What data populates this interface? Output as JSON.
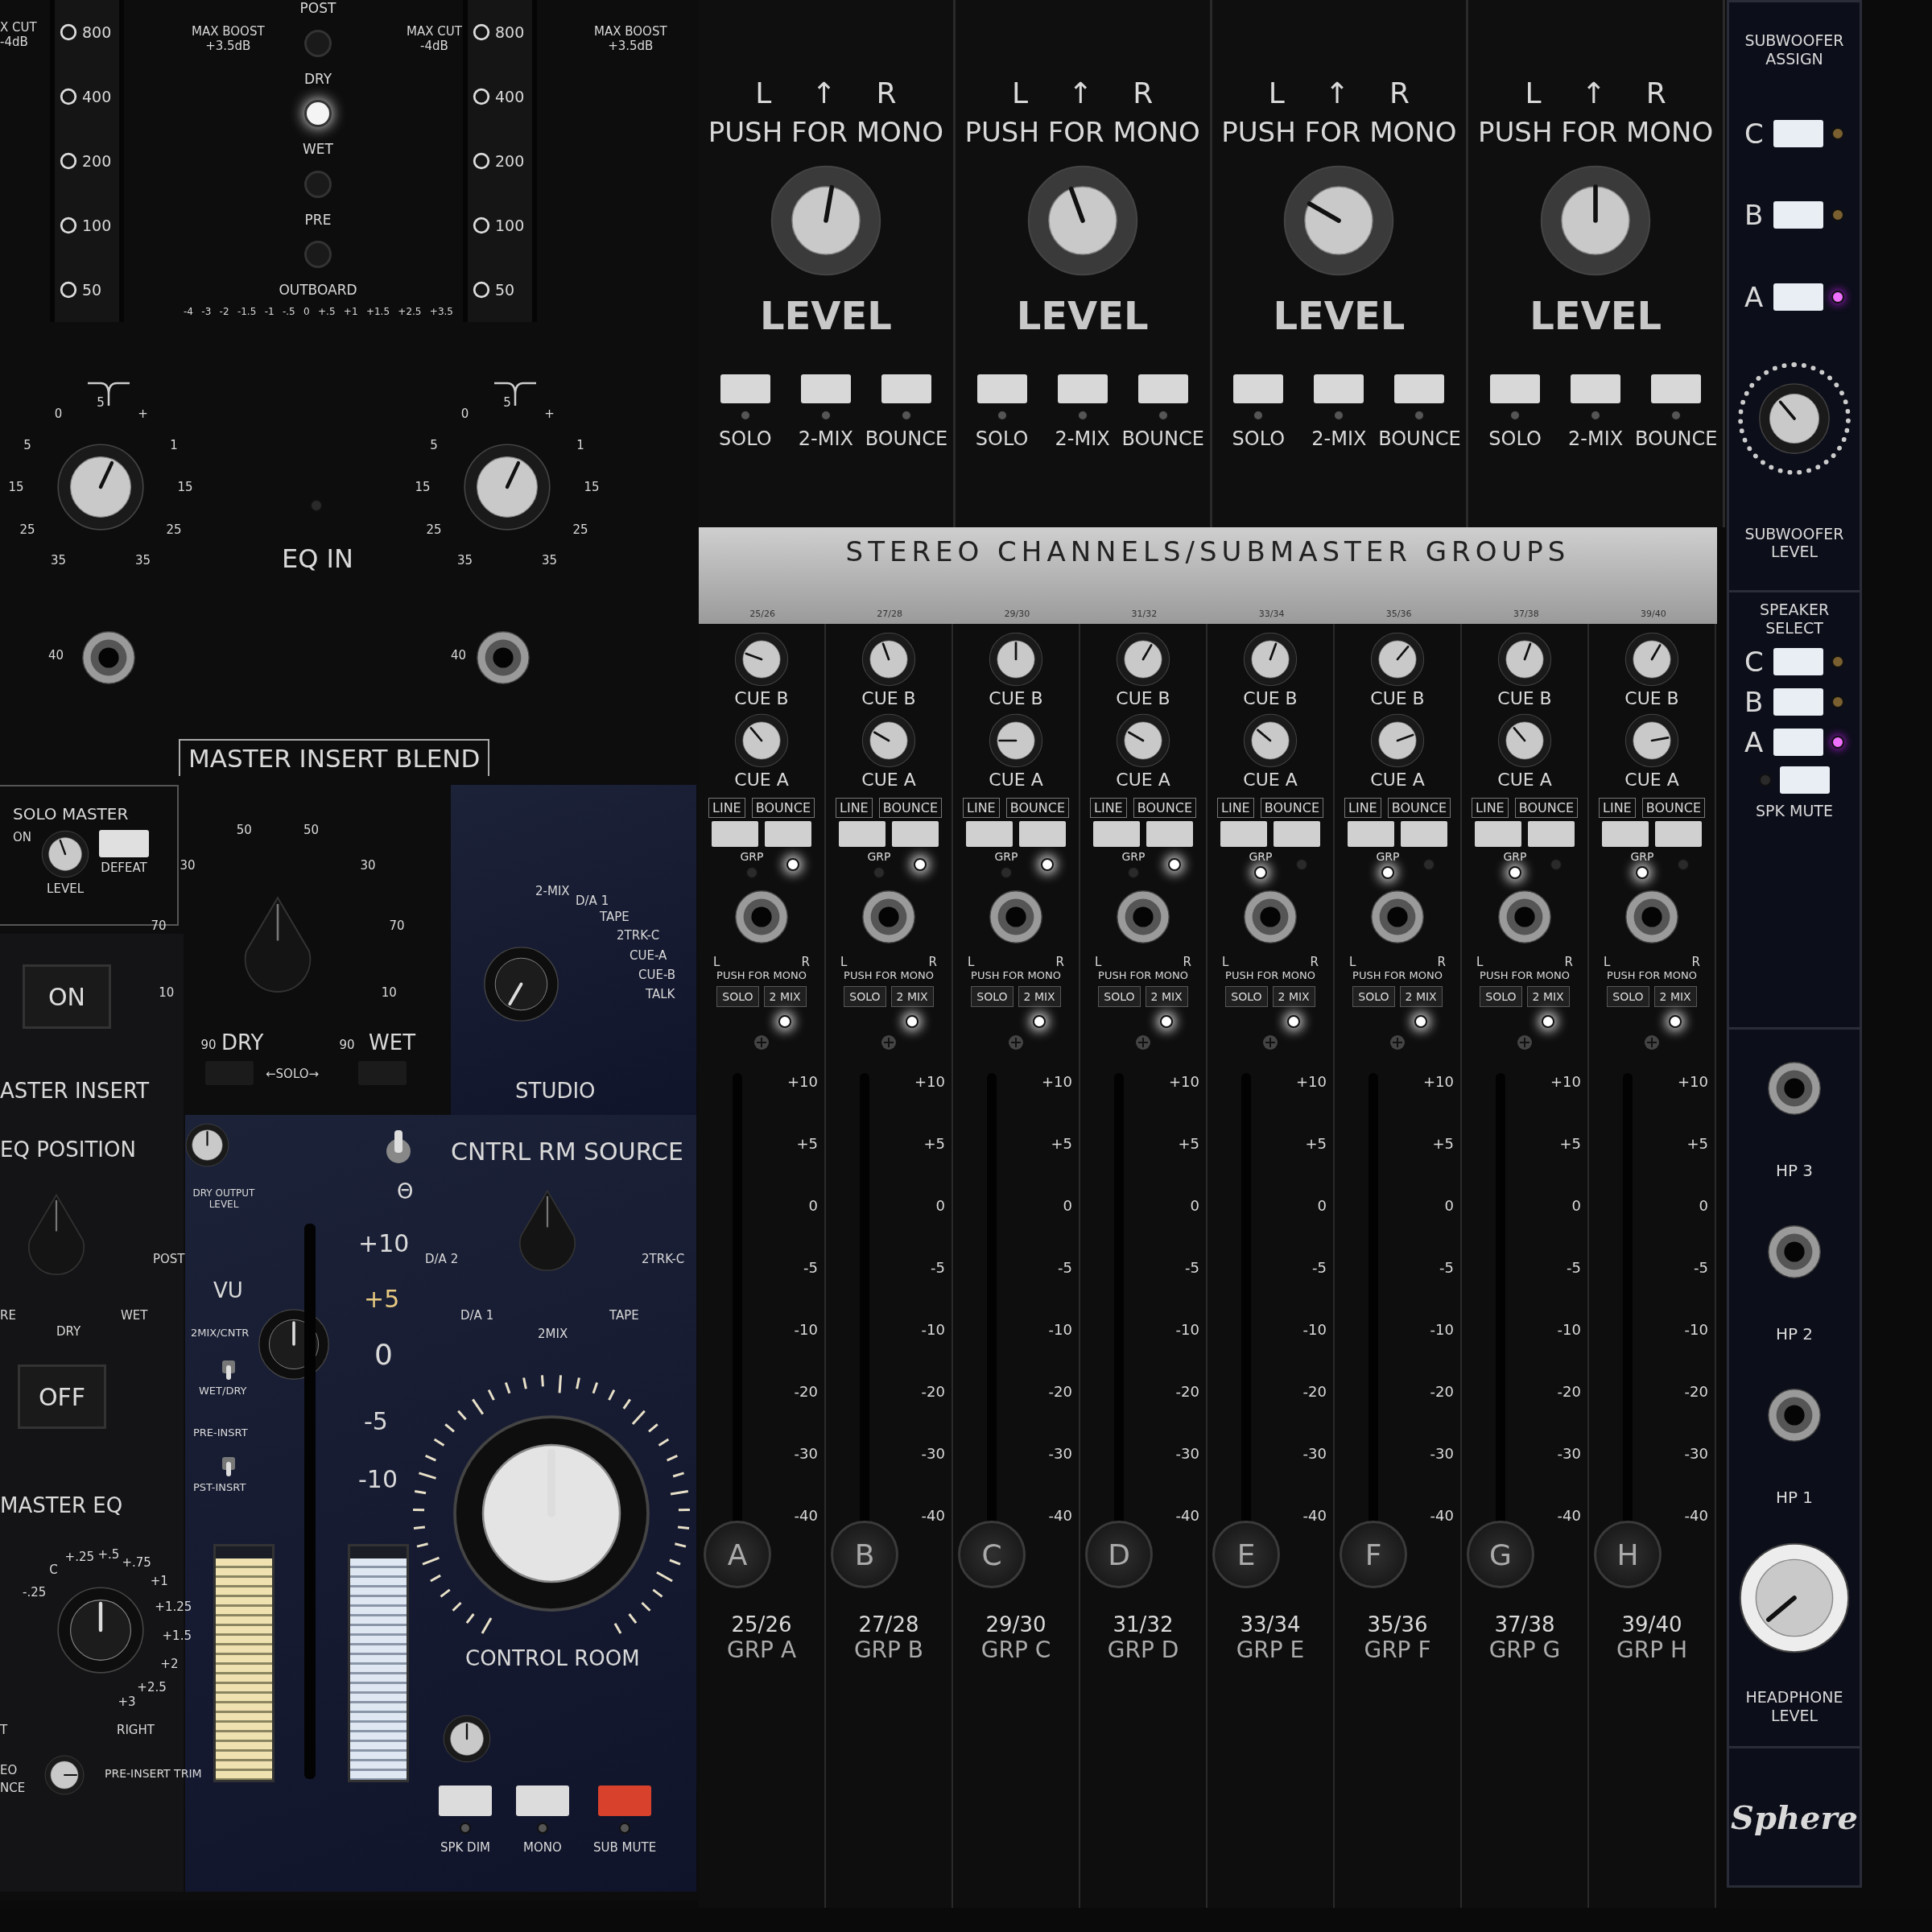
{
  "eq_top": {
    "edge_label": [
      "X CUT",
      "-4dB"
    ],
    "freq_columns": [
      {
        "values": [
          "800",
          "400",
          "200",
          "100",
          "50"
        ]
      },
      {
        "values": [
          "800",
          "400",
          "200",
          "100",
          "50"
        ]
      }
    ],
    "range_labels": [
      {
        "title": "MAX BOOST",
        "value": "+3.5dB"
      },
      {
        "title": "MAX CUT",
        "value": "-4dB"
      },
      {
        "title": "MAX BOOST",
        "value": "+3.5dB"
      }
    ],
    "insert_labels": [
      "POST",
      "DRY",
      "WET",
      "PRE",
      "OUTBOARD"
    ],
    "insert_leds": [
      {
        "on": false
      },
      {
        "on": true
      },
      {
        "on": false
      },
      {
        "on": false
      }
    ],
    "scale": [
      "-4",
      "-3",
      "-2",
      "-1.5",
      "-1",
      "-.5",
      "0",
      "+.5",
      "+1",
      "+1.5",
      "+2.5",
      "+3.5"
    ]
  },
  "filters": {
    "knobs": [
      {
        "scale": [
          "35",
          "25",
          "15",
          "5",
          "0",
          "5",
          "+",
          "1",
          "15",
          "25",
          "35"
        ]
      },
      {
        "scale": [
          "35",
          "25",
          "15",
          "5",
          "0",
          "5",
          "+",
          "1",
          "15",
          "25",
          "35"
        ]
      }
    ],
    "switch_label": "EQ IN",
    "jack_labels": [
      "40",
      "40"
    ]
  },
  "blend": {
    "title": "MASTER INSERT BLEND",
    "solo_master": {
      "title": "SOLO MASTER",
      "on_label": "ON",
      "level_label": "LEVEL",
      "defeat_label": "DEFEAT"
    },
    "scale": [
      "90",
      "10",
      "70",
      "30",
      "50",
      "50",
      "30",
      "70",
      "10",
      "90"
    ],
    "dry": "DRY",
    "solo": "←SOLO→",
    "wet": "WET"
  },
  "studio": {
    "options": [
      "2-MIX",
      "D/A 1",
      "TAPE",
      "2TRK-C",
      "CUE-A",
      "CUE-B",
      "TALK"
    ],
    "label": "STUDIO"
  },
  "insert": {
    "on_button": "ON",
    "title": "ASTER INSERT",
    "eq_position": "EQ POSITION",
    "positions": [
      "RE",
      "DRY",
      "WET",
      "POST"
    ],
    "dry_output": "DRY OUTPUT LEVEL",
    "off_button": "OFF",
    "master_eq": "MASTER EQ",
    "eq_scale": [
      "-.25",
      "C",
      "+.25",
      "+.5",
      "+.75",
      "+1",
      "+1.25",
      "+1.5",
      "+2",
      "+2.5",
      "+3"
    ],
    "edge_labels": [
      "T",
      "EO",
      "NCE"
    ],
    "right": "RIGHT",
    "trim": "PRE-INSERT TRIM"
  },
  "control_room": {
    "source_title": "CNTRL RM SOURCE",
    "toggle_label": "Θ",
    "toggle_up": true,
    "source_options": [
      "D/A 2",
      "2TRK-C",
      "D/A 1",
      "TAPE",
      "2MIX"
    ],
    "vu_scale": [
      "+10",
      "+5",
      "0",
      "-5",
      "-10"
    ],
    "vu_title": "VU",
    "vu_switches": [
      {
        "top": "2MIX/CNTR",
        "bottom": "WET/DRY",
        "up": false
      },
      {
        "top": "PRE-INSRT",
        "bottom": "PST-INSRT",
        "up": false
      }
    ],
    "meters": [
      {
        "level": 0.95
      },
      {
        "level": 0.95
      }
    ],
    "knob_label": "CONTROL ROOM",
    "buttons": [
      {
        "label": "SPK DIM",
        "color": "#dcdcdc"
      },
      {
        "label": "MONO",
        "color": "#dcdcdc"
      },
      {
        "label": "SUB MUTE",
        "color": "#d8412c"
      }
    ]
  },
  "stereo_masters": [
    {
      "pan_left": "L",
      "pan_arrow": "↑",
      "pan_right": "R",
      "mono": "PUSH FOR MONO",
      "label": "LEVEL",
      "buttons": [
        "SOLO",
        "2-MIX",
        "BOUNCE"
      ]
    },
    {
      "pan_left": "L",
      "pan_arrow": "↑",
      "pan_right": "R",
      "mono": "PUSH FOR MONO",
      "label": "LEVEL",
      "buttons": [
        "SOLO",
        "2-MIX",
        "BOUNCE"
      ]
    },
    {
      "pan_left": "L",
      "pan_arrow": "↑",
      "pan_right": "R",
      "mono": "PUSH FOR MONO",
      "label": "LEVEL",
      "buttons": [
        "SOLO",
        "2-MIX",
        "BOUNCE"
      ]
    },
    {
      "pan_left": "L",
      "pan_arrow": "↑",
      "pan_right": "R",
      "mono": "PUSH FOR MONO",
      "label": "LEVEL",
      "buttons": [
        "SOLO",
        "2-MIX",
        "BOUNCE"
      ]
    }
  ],
  "banner": "STEREO CHANNELS/SUBMASTER GROUPS",
  "channels": [
    {
      "pair": "25/26",
      "cue_b": "CUE B",
      "cue_a": "CUE A",
      "line": "LINE",
      "bounce": "BOUNCE",
      "grp": "GRP",
      "grp_on": false,
      "bounce_on": true,
      "pan_left": "L",
      "pan_right": "R",
      "mono": "PUSH FOR MONO",
      "solo": "SOLO",
      "two_mix": "2 MIX",
      "two_mix_on": true,
      "scale": [
        "+10",
        "+5",
        "0",
        "-5",
        "-10",
        "-20",
        "-30",
        "-40"
      ],
      "level": 0,
      "cap": "A",
      "bottom_pair": "25/26",
      "group": "GRP A"
    },
    {
      "pair": "27/28",
      "cue_b": "CUE B",
      "cue_a": "CUE A",
      "line": "LINE",
      "bounce": "BOUNCE",
      "grp": "GRP",
      "grp_on": false,
      "bounce_on": true,
      "pan_left": "L",
      "pan_right": "R",
      "mono": "PUSH FOR MONO",
      "solo": "SOLO",
      "two_mix": "2 MIX",
      "two_mix_on": true,
      "scale": [
        "+10",
        "+5",
        "0",
        "-5",
        "-10",
        "-20",
        "-30",
        "-40"
      ],
      "level": 0,
      "cap": "B",
      "bottom_pair": "27/28",
      "group": "GRP B"
    },
    {
      "pair": "29/30",
      "cue_b": "CUE B",
      "cue_a": "CUE A",
      "line": "LINE",
      "bounce": "BOUNCE",
      "grp": "GRP",
      "grp_on": false,
      "bounce_on": true,
      "pan_left": "L",
      "pan_right": "R",
      "mono": "PUSH FOR MONO",
      "solo": "SOLO",
      "two_mix": "2 MIX",
      "two_mix_on": true,
      "scale": [
        "+10",
        "+5",
        "0",
        "-5",
        "-10",
        "-20",
        "-30",
        "-40"
      ],
      "level": 0,
      "cap": "C",
      "bottom_pair": "29/30",
      "group": "GRP C"
    },
    {
      "pair": "31/32",
      "cue_b": "CUE B",
      "cue_a": "CUE A",
      "line": "LINE",
      "bounce": "BOUNCE",
      "grp": "GRP",
      "grp_on": false,
      "bounce_on": true,
      "pan_left": "L",
      "pan_right": "R",
      "mono": "PUSH FOR MONO",
      "solo": "SOLO",
      "two_mix": "2 MIX",
      "two_mix_on": true,
      "scale": [
        "+10",
        "+5",
        "0",
        "-5",
        "-10",
        "-20",
        "-30",
        "-40"
      ],
      "level": 0,
      "cap": "D",
      "bottom_pair": "31/32",
      "group": "GRP D"
    },
    {
      "pair": "33/34",
      "cue_b": "CUE B",
      "cue_a": "CUE A",
      "line": "LINE",
      "bounce": "BOUNCE",
      "grp": "GRP",
      "grp_on": true,
      "bounce_on": false,
      "pan_left": "L",
      "pan_right": "R",
      "mono": "PUSH FOR MONO",
      "solo": "SOLO",
      "two_mix": "2 MIX",
      "two_mix_on": true,
      "scale": [
        "+10",
        "+5",
        "0",
        "-5",
        "-10",
        "-20",
        "-30",
        "-40"
      ],
      "level": 0,
      "cap": "E",
      "bottom_pair": "33/34",
      "group": "GRP E"
    },
    {
      "pair": "35/36",
      "cue_b": "CUE B",
      "cue_a": "CUE A",
      "line": "LINE",
      "bounce": "BOUNCE",
      "grp": "GRP",
      "grp_on": true,
      "bounce_on": false,
      "pan_left": "L",
      "pan_right": "R",
      "mono": "PUSH FOR MONO",
      "solo": "SOLO",
      "two_mix": "2 MIX",
      "two_mix_on": true,
      "scale": [
        "+10",
        "+5",
        "0",
        "-5",
        "-10",
        "-20",
        "-30",
        "-40"
      ],
      "level": 0,
      "cap": "F",
      "bottom_pair": "35/36",
      "group": "GRP F"
    },
    {
      "pair": "37/38",
      "cue_b": "CUE B",
      "cue_a": "CUE A",
      "line": "LINE",
      "bounce": "BOUNCE",
      "grp": "GRP",
      "grp_on": true,
      "bounce_on": false,
      "pan_left": "L",
      "pan_right": "R",
      "mono": "PUSH FOR MONO",
      "solo": "SOLO",
      "two_mix": "2 MIX",
      "two_mix_on": true,
      "scale": [
        "+10",
        "+5",
        "0",
        "-5",
        "-10",
        "-20",
        "-30",
        "-40"
      ],
      "level": 0,
      "cap": "G",
      "bottom_pair": "37/38",
      "group": "GRP G"
    },
    {
      "pair": "39/40",
      "cue_b": "CUE B",
      "cue_a": "CUE A",
      "line": "LINE",
      "bounce": "BOUNCE",
      "grp": "GRP",
      "grp_on": true,
      "bounce_on": false,
      "pan_left": "L",
      "pan_right": "R",
      "mono": "PUSH FOR MONO",
      "solo": "SOLO",
      "two_mix": "2 MIX",
      "two_mix_on": true,
      "scale": [
        "+10",
        "+5",
        "0",
        "-5",
        "-10",
        "-20",
        "-30",
        "-40"
      ],
      "level": 0,
      "cap": "H",
      "bottom_pair": "39/40",
      "group": "GRP H"
    }
  ],
  "right_strip": {
    "sub_title": "SUBWOOFER ASSIGN",
    "sub_buttons": [
      {
        "label": "C",
        "on": false
      },
      {
        "label": "B",
        "on": false
      },
      {
        "label": "A",
        "on": true
      }
    ],
    "sub_level": "SUBWOOFER LEVEL",
    "speaker_title": "SPEAKER SELECT",
    "speaker_buttons": [
      {
        "label": "C",
        "on": false
      },
      {
        "label": "B",
        "on": false
      },
      {
        "label": "A",
        "on": true
      }
    ],
    "mute_label": "SPK MUTE",
    "mute_on": false,
    "jacks": [
      "HP 3",
      "HP 2",
      "HP 1"
    ],
    "hp_level": "HEADPHONE LEVEL",
    "logo": "Sphere"
  }
}
